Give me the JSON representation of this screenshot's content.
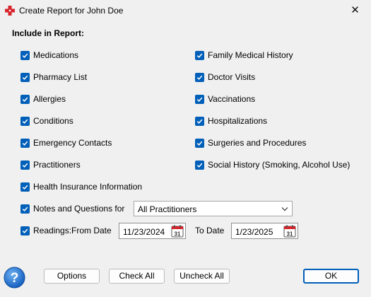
{
  "window": {
    "title": "Create Report for John Doe",
    "close_glyph": "✕",
    "accent": "#005fb8"
  },
  "section_title": "Include in Report:",
  "left_items": [
    "Medications",
    "Pharmacy List",
    "Allergies",
    "Conditions",
    "Emergency Contacts",
    "Practitioners",
    "Health Insurance Information"
  ],
  "right_items": [
    "Family Medical History",
    "Doctor Visits",
    "Vaccinations",
    "Hospitalizations",
    "Surgeries and Procedures",
    "Social History (Smoking, Alcohol Use)"
  ],
  "notes": {
    "label": "Notes and Questions for",
    "selected": "All Practitioners",
    "checked": true
  },
  "readings": {
    "label": "Readings:",
    "from_label": "From Date",
    "from_date": "11/23/2024",
    "to_label": "To Date",
    "to_date": "1/23/2025",
    "checked": true,
    "calendar_day": "31"
  },
  "buttons": {
    "options": "Options",
    "check_all": "Check All",
    "uncheck_all": "Uncheck All",
    "ok": "OK"
  }
}
